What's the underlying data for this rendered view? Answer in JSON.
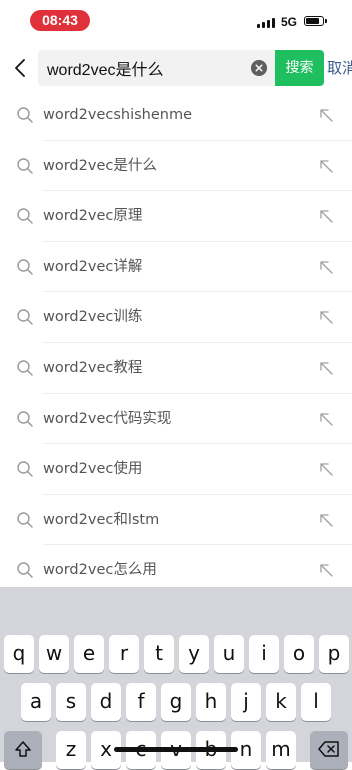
{
  "status_bar": {
    "time": "08:43",
    "network": "5G"
  },
  "search": {
    "query": "word2vec是什么",
    "button_label": "搜索",
    "cancel_label": "取消"
  },
  "suggestions": [
    "word2vecshishenme",
    "word2vec是什么",
    "word2vec原理",
    "word2vec详解",
    "word2vec训练",
    "word2vec教程",
    "word2vec代码实现",
    "word2vec使用",
    "word2vec和lstm",
    "word2vec怎么用"
  ],
  "keyboard": {
    "row1": [
      "q",
      "w",
      "e",
      "r",
      "t",
      "y",
      "u",
      "i",
      "o",
      "p"
    ],
    "row2": [
      "a",
      "s",
      "d",
      "f",
      "g",
      "h",
      "j",
      "k",
      "l"
    ],
    "row3": [
      "z",
      "x",
      "c",
      "v",
      "b",
      "n",
      "m"
    ]
  },
  "colors": {
    "status_pill": "#e0303a",
    "search_button": "#1fbf60",
    "cancel_text": "#3a5a8c",
    "keyboard_bg": "#d3d5db"
  },
  "icons": {
    "back": "chevron-left-icon",
    "clear": "clear-circle-icon",
    "suggestion": "search-icon",
    "fill": "arrow-up-left-icon",
    "shift": "shift-icon",
    "delete": "backspace-icon"
  }
}
